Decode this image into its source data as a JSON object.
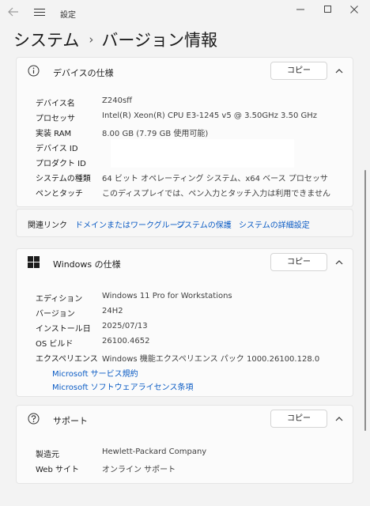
{
  "titlebar": {
    "title": "設定"
  },
  "heading": {
    "section": "システム",
    "separator": "›",
    "page": "バージョン情報"
  },
  "device_card": {
    "title": "デバイスの仕様",
    "copy_label": "コピー",
    "rows": [
      {
        "label": "デバイス名",
        "value": "Z240sff"
      },
      {
        "label": "プロセッサ",
        "value": "Intel(R) Xeon(R) CPU E3-1245 v5 @ 3.50GHz   3.50 GHz"
      },
      {
        "label": "実装 RAM",
        "value": "8.00 GB (7.79 GB 使用可能)"
      },
      {
        "label": "デバイス ID",
        "value": ""
      },
      {
        "label": "プロダクト ID",
        "value": ""
      },
      {
        "label": "システムの種類",
        "value": "64 ビット オペレーティング システム、x64 ベース プロセッサ"
      },
      {
        "label": "ペンとタッチ",
        "value": "このディスプレイでは、ペン入力とタッチ入力は利用できません"
      }
    ]
  },
  "related_links": {
    "title": "関連リンク",
    "links": [
      "ドメインまたはワークグループ",
      "システムの保護",
      "システムの詳細設定"
    ]
  },
  "windows_card": {
    "title": "Windows の仕様",
    "copy_label": "コピー",
    "rows": [
      {
        "label": "エディション",
        "value": "Windows 11 Pro for Workstations"
      },
      {
        "label": "バージョン",
        "value": "24H2"
      },
      {
        "label": "インストール日",
        "value": "2025/07/13"
      },
      {
        "label": "OS ビルド",
        "value": "26100.4652"
      },
      {
        "label": "エクスペリエンス",
        "value": "Windows 機能エクスペリエンス パック 1000.26100.128.0"
      }
    ],
    "links": [
      "Microsoft サービス規約",
      "Microsoft ソフトウェアライセンス条項"
    ]
  },
  "support_card": {
    "title": "サポート",
    "copy_label": "コピー",
    "rows": [
      {
        "label": "製造元",
        "value": "Hewlett-Packard Company"
      },
      {
        "label": "Web サイト",
        "value": "オンライン サポート"
      }
    ]
  },
  "colors": {
    "accent": "#0a5bc4",
    "background": "#f3f3f3",
    "card": "#fbfbfb"
  },
  "icons": [
    "back-arrow-icon",
    "hamburger-menu-icon",
    "minimize-icon",
    "maximize-icon",
    "close-icon",
    "info-icon",
    "windows-logo-icon",
    "help-icon",
    "chevron-up-icon"
  ]
}
